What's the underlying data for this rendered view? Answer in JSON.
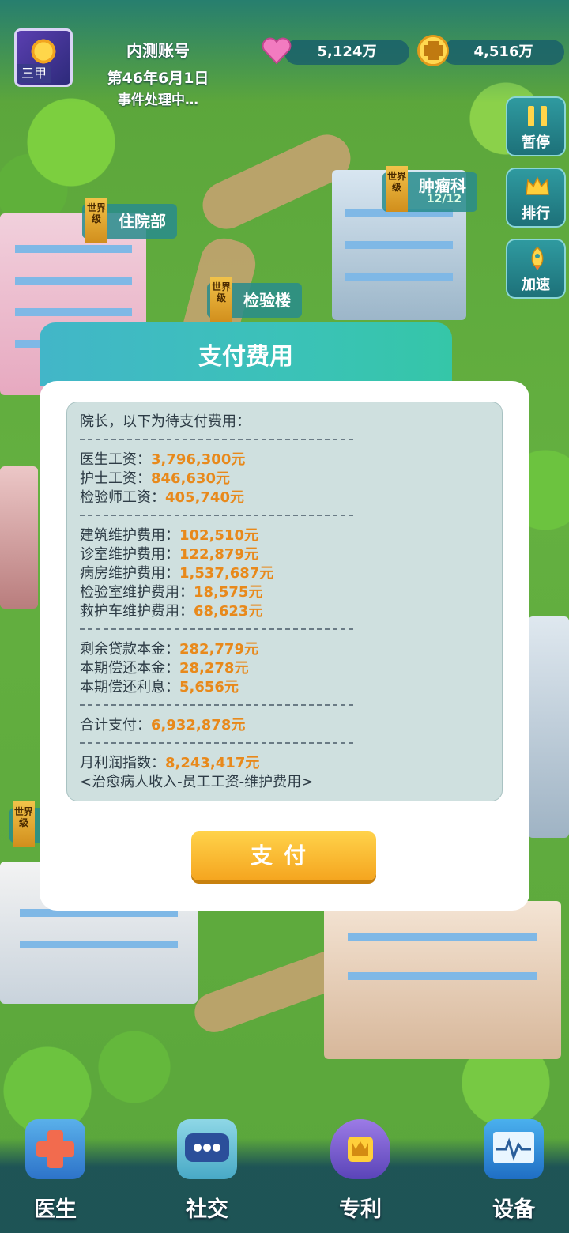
{
  "header": {
    "account_name": "内测账号",
    "rank_label": "三甲",
    "date": "第46年6月1日",
    "status": "事件处理中…",
    "hearts": "5,124万",
    "coins": "4,516万"
  },
  "side_buttons": [
    {
      "label": "暂停",
      "icon": "pause-icon"
    },
    {
      "label": "排行",
      "icon": "crown-icon"
    },
    {
      "label": "加速",
      "icon": "rocket-icon"
    }
  ],
  "buildings": [
    {
      "name": "住院部",
      "tier": "世界级"
    },
    {
      "name": "检验楼",
      "tier": "世界级"
    },
    {
      "name": "肿瘤科",
      "tier": "世界级",
      "sub": "12/12"
    },
    {
      "tier": "世界级"
    }
  ],
  "dialog": {
    "title": "支付费用",
    "intro": "院长，以下为待支付费用：",
    "separator": "------------------------------",
    "salaries": [
      {
        "label": "医生工资：",
        "value": "3,796,300元"
      },
      {
        "label": "护士工资：",
        "value": "846,630元"
      },
      {
        "label": "检验师工资：",
        "value": "405,740元"
      }
    ],
    "maintenance": [
      {
        "label": "建筑维护费用：",
        "value": "102,510元"
      },
      {
        "label": "诊室维护费用：",
        "value": "122,879元"
      },
      {
        "label": "病房维护费用：",
        "value": "1,537,687元"
      },
      {
        "label": "检验室维护费用：",
        "value": "18,575元"
      },
      {
        "label": "救护车维护费用：",
        "value": "68,623元"
      }
    ],
    "loans": [
      {
        "label": "剩余贷款本金：",
        "value": "282,779元"
      },
      {
        "label": "本期偿还本金：",
        "value": "28,278元"
      },
      {
        "label": "本期偿还利息：",
        "value": "5,656元"
      }
    ],
    "total": {
      "label": "合计支付：",
      "value": "6,932,878元"
    },
    "profit": {
      "label": "月利润指数：",
      "value": "8,243,417元"
    },
    "profit_note": "<治愈病人收入-员工工资-维护费用>",
    "pay_button": "支付"
  },
  "bottom_nav": [
    {
      "label": "医生",
      "icon": "doctor-cross-icon"
    },
    {
      "label": "社交",
      "icon": "chat-bubble-icon"
    },
    {
      "label": "专利",
      "icon": "patent-shield-icon"
    },
    {
      "label": "设备",
      "icon": "monitor-heartbeat-icon"
    }
  ],
  "colors": {
    "dialog_header": "#3bc2b8",
    "value_text": "#e8891b",
    "pay_button": "#f5a51f",
    "panel_bg": "#cfe0df"
  }
}
